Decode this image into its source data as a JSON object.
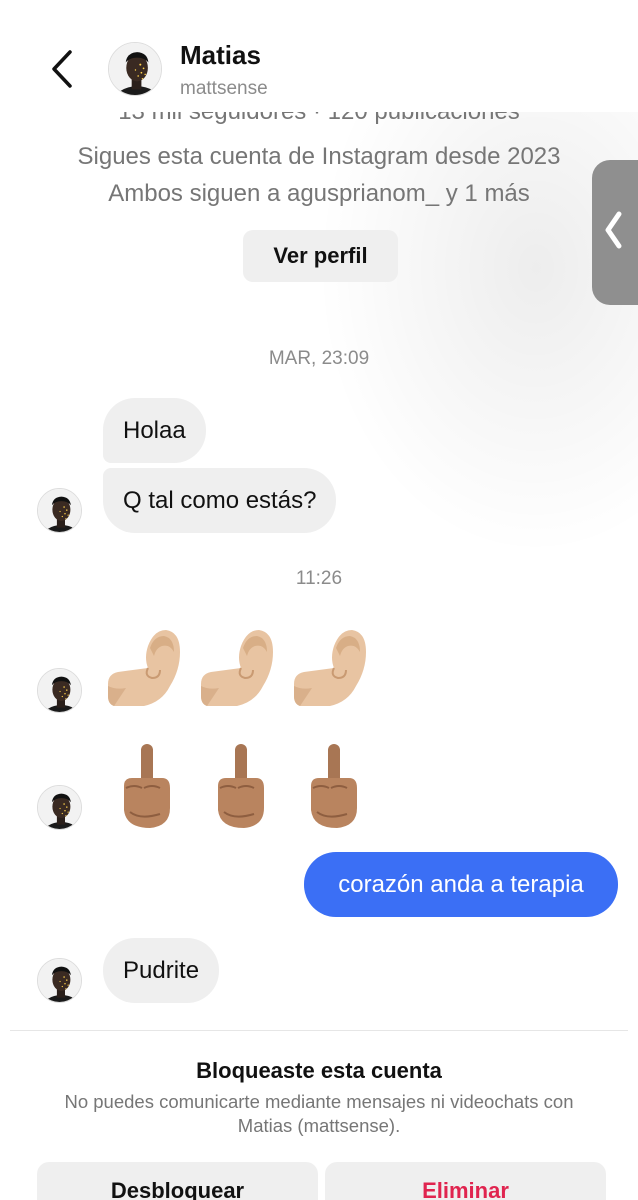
{
  "header": {
    "name": "Matias",
    "username": "mattsense"
  },
  "profile": {
    "stats": "13 mil seguidores · 120 publicaciones",
    "following_since": "Sigues esta cuenta de Instagram desde 2023",
    "mutuals": "Ambos siguen a agusprianom_ y 1 más",
    "view_profile_label": "Ver perfil"
  },
  "chat": {
    "timestamp_1": "MAR, 23:09",
    "msg_1": "Holaa",
    "msg_2": "Q tal como estás?",
    "timestamp_2": "11:26",
    "sent_msg": "corazón anda a terapia",
    "msg_last": "Pudrite"
  },
  "footer": {
    "blocked_title": "Bloqueaste esta cuenta",
    "blocked_desc": "No puedes comunicarte mediante mensajes ni videochats con Matias (mattsense).",
    "unblock_label": "Desbloquear",
    "delete_label": "Eliminar"
  },
  "colors": {
    "sent_bubble": "#3b6ff5",
    "received_bubble": "#efefef",
    "delete_text": "#e0244f"
  },
  "icons": {
    "back": "chevron-left-icon",
    "handle": "chevron-left-icon",
    "emoji_pinched": "pinched-fingers-emoji",
    "emoji_middle": "middle-finger-emoji"
  }
}
